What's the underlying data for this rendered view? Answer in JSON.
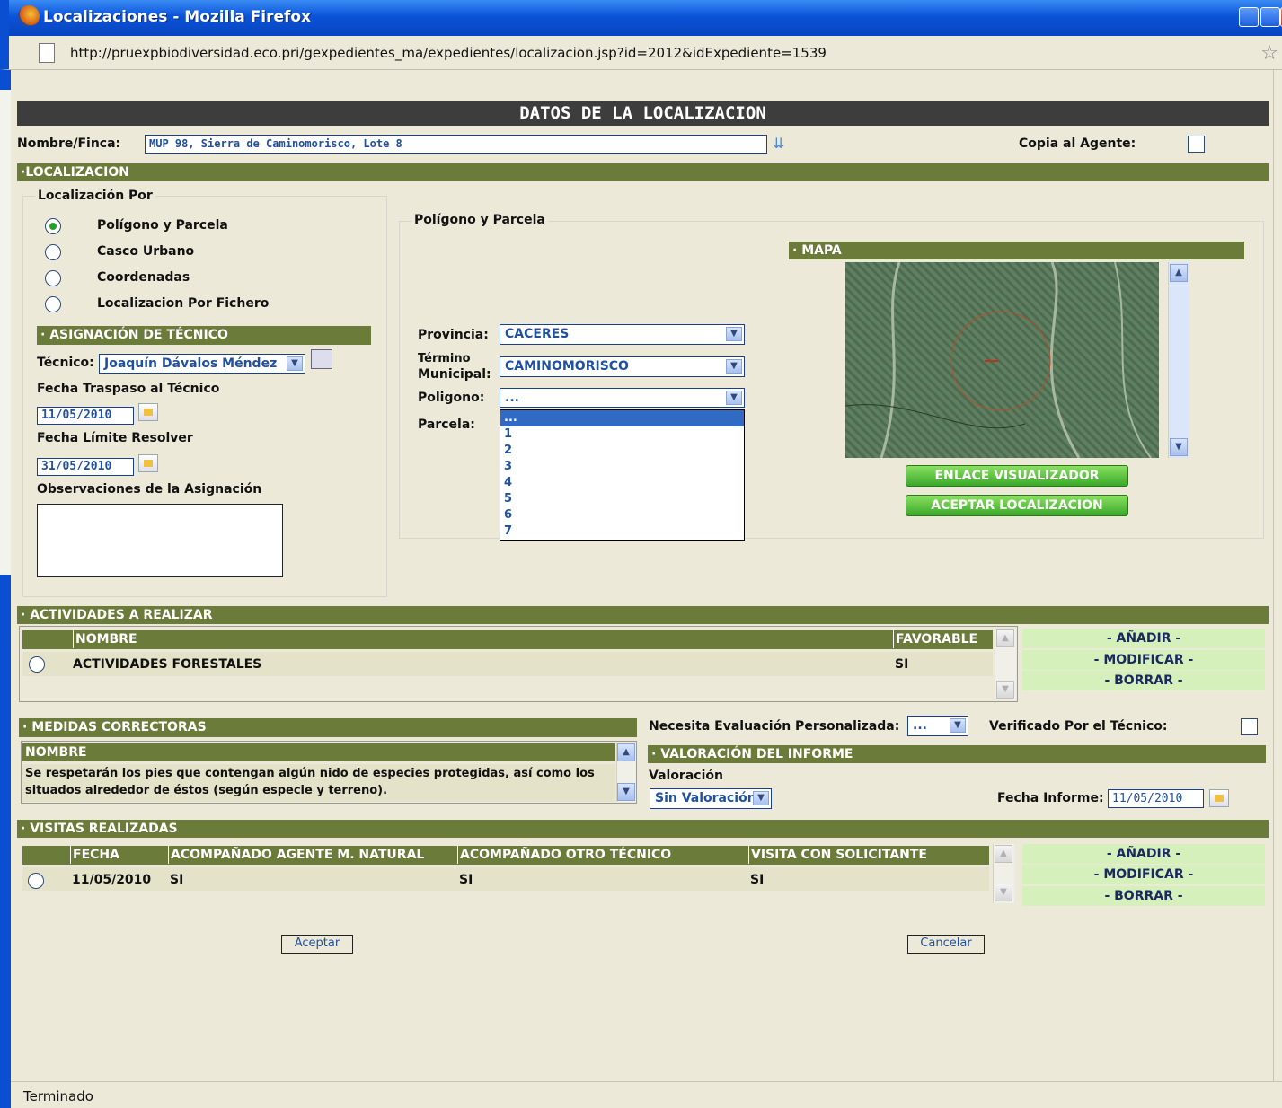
{
  "window": {
    "title": "Localizaciones - Mozilla Firefox",
    "url": "http://pruexpbiodiversidad.eco.pri/gexpedientes_ma/expedientes/localizacion.jsp?id=2012&idExpediente=1539",
    "status": "Terminado"
  },
  "header": {
    "title": "DATOS DE LA LOCALIZACION"
  },
  "finca": {
    "label": "Nombre/Finca:",
    "value": "MUP 98, Sierra de Caminomorisco, Lote 8",
    "copia_label": "Copia al Agente:"
  },
  "localizacion": {
    "section": "·LOCALIZACION",
    "por_label": "Localización Por",
    "options": [
      "Polígono y Parcela",
      "Casco Urbano",
      "Coordenadas",
      "Localizacion Por Fichero"
    ],
    "selected": 0,
    "poligono_title": "Polígono y Parcela",
    "provincia_label": "Provincia:",
    "provincia_value": "CACERES",
    "termino_label_1": "Término",
    "termino_label_2": "Municipal:",
    "termino_value": "CAMINOMORISCO",
    "poligono_label": "Poligono:",
    "poligono_value": "...",
    "parcela_label": "Parcela:",
    "poligono_options": [
      "...",
      "1",
      "2",
      "3",
      "4",
      "5",
      "6",
      "7"
    ]
  },
  "mapa": {
    "section": "· MAPA",
    "enlace": "ENLACE VISUALIZADOR",
    "aceptar": "ACEPTAR LOCALIZACION"
  },
  "tecnico": {
    "section": "· ASIGNACIÓN DE TÉCNICO",
    "label": "Técnico:",
    "value": "Joaquín Dávalos Méndez",
    "fecha_traspaso_label": "Fecha Traspaso al Técnico",
    "fecha_traspaso": "11/05/2010",
    "fecha_limite_label": "Fecha Límite Resolver",
    "fecha_limite": "31/05/2010",
    "observaciones_label": "Observaciones de la Asignación"
  },
  "actividades": {
    "section": "· ACTIVIDADES A REALIZAR",
    "col_nombre": "NOMBRE",
    "col_favorable": "FAVORABLE",
    "rows": [
      {
        "nombre": "ACTIVIDADES FORESTALES",
        "favorable": "SI"
      }
    ],
    "add": "- AÑADIR -",
    "modify": "- MODIFICAR -",
    "delete": "- BORRAR -"
  },
  "medidas": {
    "section": "· MEDIDAS CORRECTORAS",
    "col_nombre": "NOMBRE",
    "text_1": "Se respetarán los pies que contengan algún nido de especies protegidas, así como los",
    "text_2": "situados alrededor de éstos (según especie y terreno)."
  },
  "evaluacion": {
    "label": "Necesita Evaluación Personalizada:",
    "value": "...",
    "verificado_label": "Verificado Por el Técnico:"
  },
  "valoracion": {
    "section": "· VALORACIÓN DEL INFORME",
    "label": "Valoración",
    "value": "Sin Valoración",
    "fecha_label": "Fecha Informe:",
    "fecha": "11/05/2010"
  },
  "visitas": {
    "section": "· VISITAS REALIZADAS",
    "col_fecha": "FECHA",
    "col_agente": "ACOMPAÑADO AGENTE M. NATURAL",
    "col_tecnico": "ACOMPAÑADO OTRO TÉCNICO",
    "col_solicitante": "VISITA CON SOLICITANTE",
    "rows": [
      {
        "fecha": "11/05/2010",
        "agente": "SI",
        "tecnico": "SI",
        "solicitante": "SI"
      }
    ],
    "add": "- AÑADIR -",
    "modify": "- MODIFICAR -",
    "delete": "- BORRAR -"
  },
  "footer": {
    "aceptar": "Aceptar",
    "cancelar": "Cancelar"
  }
}
